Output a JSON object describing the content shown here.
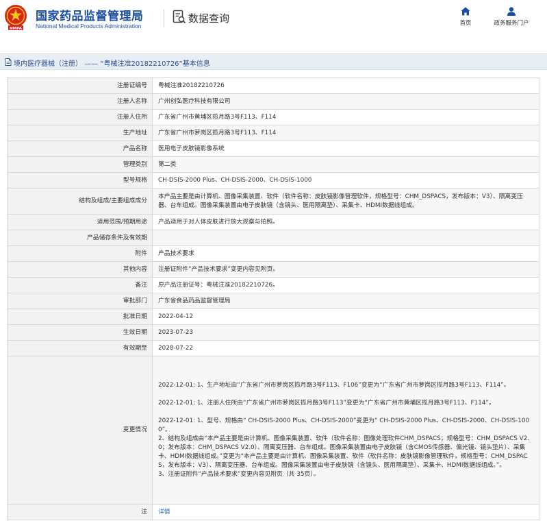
{
  "header": {
    "title": "国家药品监督管理局",
    "subtitle": "National Medical Products Administration",
    "query_label": "数据查询",
    "logo_text": "NMPA",
    "nav": [
      {
        "label": "首页",
        "icon": "home-icon"
      },
      {
        "label": "政务服务门户",
        "icon": "user-icon"
      }
    ]
  },
  "breadcrumb": {
    "section": "境内医疗器械（注册）",
    "separator": "——",
    "title": "“粤械注准20182210726”基本信息"
  },
  "rows": [
    {
      "label": "注册证编号",
      "value": "粤械注准20182210726"
    },
    {
      "label": "注册人名称",
      "value": "广州创弘医疗科技有限公司"
    },
    {
      "label": "注册人住所",
      "value": "广东省广州市黄埔区揽月路3号F113、F114"
    },
    {
      "label": "生产地址",
      "value": "广东省广州市萝岗区揽月路3号F113、F114"
    },
    {
      "label": "产品名称",
      "value": "医用电子皮肤镜影像系统"
    },
    {
      "label": "管理类别",
      "value": "第二类"
    },
    {
      "label": "型号规格",
      "value": "CH-DSIS-2000 Plus、CH-DSIS-2000、CH-DSIS-1000"
    },
    {
      "label": "结构及组成/主要组成成分",
      "value": "本产品主要是由计算机、图像采集装置、软件（软件名称：皮肤镜影像管理软件，规格型号：CHM_DSPACS，发布版本：V3）、隔离变压器、台车组成。图像采集装置由电子皮肤镜（含镜头、医用隔离垫）、采集卡、HDMI数据线组成。"
    },
    {
      "label": "适用范围/预期用途",
      "value": "产品适用于对人体皮肤进行放大观察与拍照。"
    },
    {
      "label": "产品储存条件及有效期",
      "value": ""
    },
    {
      "label": "附件",
      "value": "产品技术要求"
    },
    {
      "label": "其他内容",
      "value": "注册证附件“产品技术要求”变更内容见附页。"
    },
    {
      "label": "备注",
      "value": "原产品注册证号：粤械注准20182210726。"
    },
    {
      "label": "审批部门",
      "value": "广东省食品药品监督管理局"
    },
    {
      "label": "批准日期",
      "value": "2022-04-12"
    },
    {
      "label": "生效日期",
      "value": "2023-07-23"
    },
    {
      "label": "有效期至",
      "value": "2028-07-22"
    }
  ],
  "changes": {
    "label": "变更情况",
    "para1": "2022-12-01: 1、生产地址由“广东省广州市萝岗区揽月路3号F113、F106”变更为“广东省广州市萝岗区揽月路3号F113、F114”。",
    "para2": "2022-12-01: 1、注册人住所由“广东省广州市萝岗区揽月路3号F113”变更为“广东省广州市黄埔区揽月路3号F113、F114”。",
    "para3_line1": "2022-12-01: 1、型号、规格由“ CH-DSIS-2000 Plus、CH-DSIS-2000”变更为“ CH-DSIS-2000 Plus、CH-DSIS-2000、CH-DSIS-1000”。",
    "para3_line2": "2、结构及组成由“本产品主要是由计算机、图像采集装置、软件（软件名称：图像处理软件CHM_DSPACS；规格型号：CHM_DSPACS V2.0；发布版本：CHM_DSPACS V2.0）、隔离变压器、台车组成。图像采集装置由电子皮肤镜（含CMOS传感器、偏光镜、镜头垫片）、采集卡、HDMI数据线组成。”变更为“本产品主要是由计算机、图像采集装置、软件（软件名称：皮肤镜影像管理软件，规格型号：CHM_DSPACS，发布版本：V3）、隔离变压器、台车组成。图像采集装置由电子皮肤镜（含镜头、医用隔离垫）、采集卡、HDMI数据线组成。”。",
    "para3_line3": "3、注册证附件“产品技术要求”变更内容见附页（共 35页）。"
  },
  "annotation": {
    "label": "注",
    "link": "详情"
  },
  "colors": {
    "brand": "#1a4ea2",
    "label_bg": "#f2f2f2",
    "bar_bg": "#e9edf4",
    "logo_red": "#d7261e",
    "link": "#2a6cc2"
  }
}
